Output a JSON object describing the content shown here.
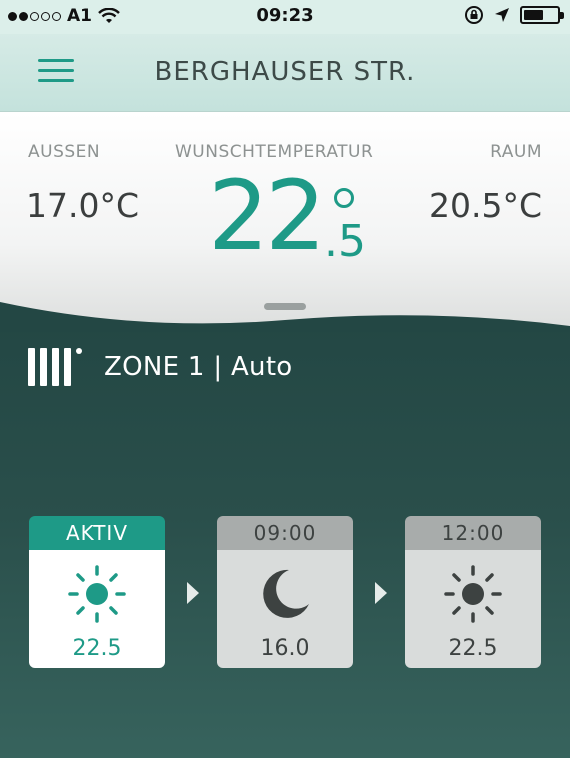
{
  "status_bar": {
    "carrier": "A1",
    "time": "09:23",
    "battery_level_percent": 60
  },
  "header": {
    "title": "BERGHAUSER STR."
  },
  "temperatures": {
    "outside_label": "AUSSEN",
    "outside_value": "17.0°C",
    "setpoint_label": "WUNSCHTEMPERATUR",
    "setpoint_integer": "22",
    "setpoint_decimal": ".5",
    "room_label": "RAUM",
    "room_value": "20.5°C"
  },
  "zone": {
    "label": "ZONE 1 | Auto"
  },
  "schedule": [
    {
      "header": "AKTIV",
      "icon": "sun-icon",
      "temperature": "22.5",
      "state": "active"
    },
    {
      "header": "09:00",
      "icon": "moon-icon",
      "temperature": "16.0",
      "state": "future"
    },
    {
      "header": "12:00",
      "icon": "sun-icon",
      "temperature": "22.5",
      "state": "future"
    }
  ],
  "colors": {
    "accent": "#1e9a87",
    "background_dark": "#2a4f4b",
    "header_bg": "#d6ebe6"
  }
}
